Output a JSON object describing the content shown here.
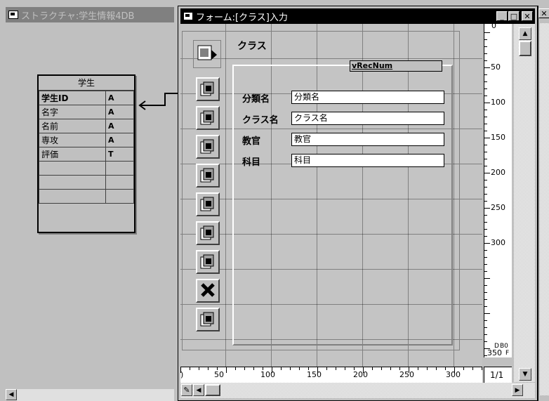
{
  "structure_window": {
    "title": "ストラクチャ:学生情報4DB",
    "table": {
      "name": "学生",
      "fields": [
        {
          "name": "学生ID",
          "type": "A",
          "bold": true
        },
        {
          "name": "名字",
          "type": "A"
        },
        {
          "name": "名前",
          "type": "A"
        },
        {
          "name": "専攻",
          "type": "A"
        },
        {
          "name": "評価",
          "type": "T"
        },
        {
          "name": "",
          "type": ""
        },
        {
          "name": "",
          "type": ""
        },
        {
          "name": "",
          "type": ""
        }
      ]
    }
  },
  "form_window": {
    "title": "フォーム:[クラス]入力",
    "header_label": "クラス",
    "rec_num_var": "vRecNum",
    "fields": [
      {
        "label": "分類名",
        "value": "分類名"
      },
      {
        "label": "クラス名",
        "value": "クラス名"
      },
      {
        "label": "教官",
        "value": "教官"
      },
      {
        "label": "科目",
        "value": "科目"
      }
    ],
    "toolbar_icons": [
      "first-record-icon",
      "previous-record-icon",
      "next-record-icon",
      "last-record-icon",
      "stack-icon",
      "delete-page-icon",
      "add-page-icon",
      "cancel-icon",
      "save-icon"
    ],
    "vertical_ruler": [
      "50",
      "100",
      "150",
      "200",
      "250",
      "300"
    ],
    "vertical_ruler_top": "0",
    "horizontal_ruler": [
      "50",
      "100",
      "150",
      "200",
      "250",
      "300"
    ],
    "horizontal_ruler_start": ")",
    "corner_markers": {
      "d": "D",
      "b": "B0",
      "f": "F",
      "num": "350"
    },
    "page_indicator": "1/1"
  }
}
